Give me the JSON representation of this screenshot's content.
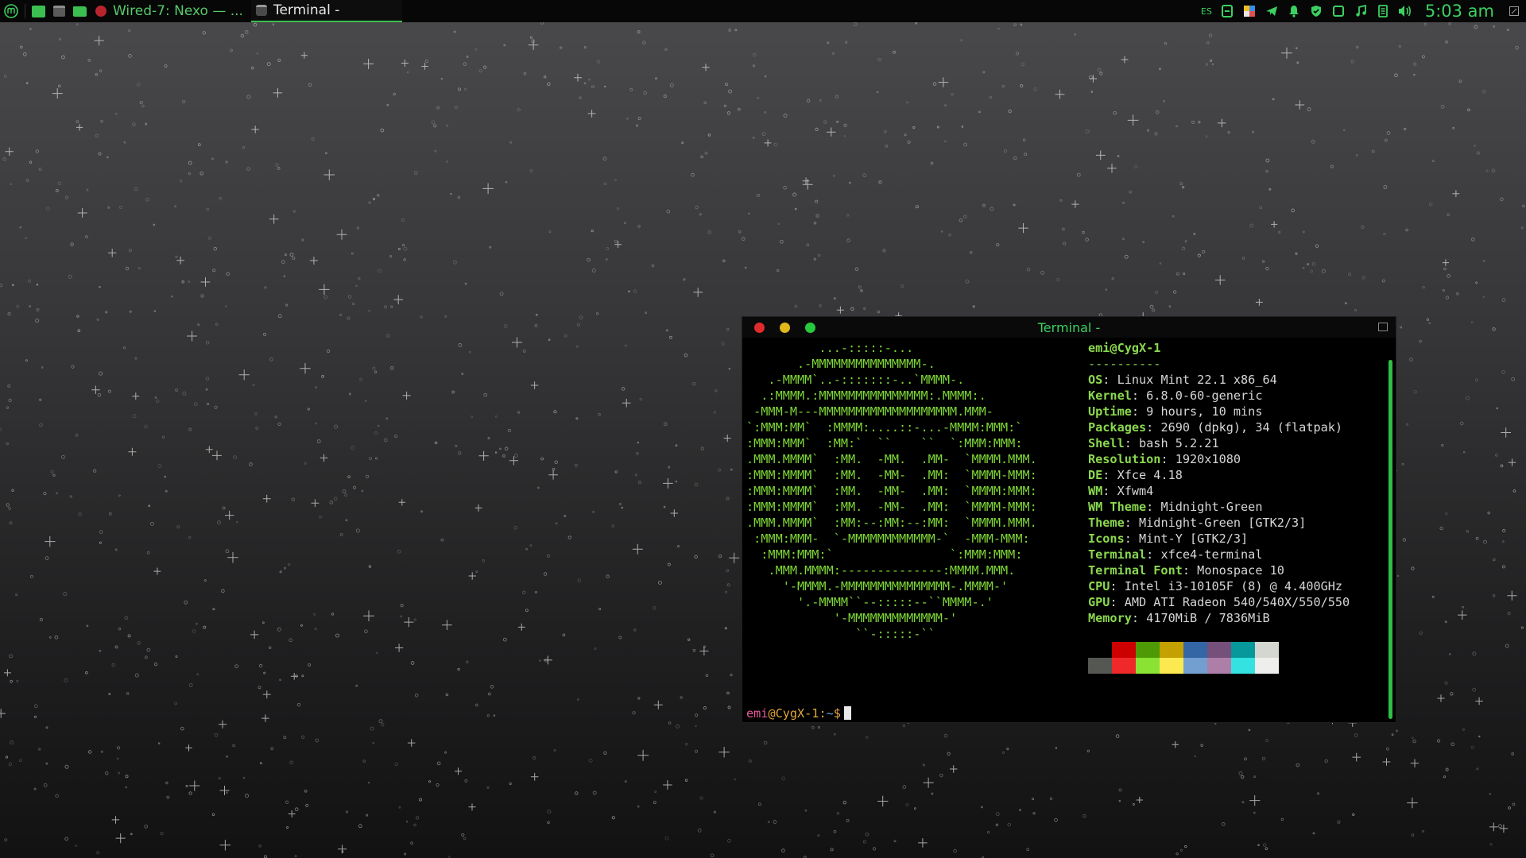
{
  "panel": {
    "tasks": [
      {
        "label": "Wired-7: Nexo — ..."
      },
      {
        "label": "Terminal -"
      }
    ],
    "keyboard_layout": "ES",
    "clock": "5:03 am",
    "accent_color": "#3cd061"
  },
  "terminal": {
    "title": "Terminal -",
    "logo": [
      "          ...-:::::-...",
      "       .-MMMMMMMMMMMMMMM-.",
      "   .-MMMM`..-:::::::-..`MMMM-.",
      "  .:MMMM.:MMMMMMMMMMMMMMM:.MMMM:.",
      " -MMM-M---MMMMMMMMMMMMMMMMMMM.MMM-",
      "`:MMM:MM`  :MMMM:....::-...-MMMM:MMM:`",
      ":MMM:MMM`  :MM:`  ``    ``  `:MMM:MMM:",
      ".MMM.MMMM`  :MM.  -MM.  .MM-  `MMMM.MMM.",
      ":MMM:MMMM`  :MM.  -MM-  .MM:  `MMMM-MMM:",
      ":MMM:MMMM`  :MM.  -MM-  .MM:  `MMMM:MMM:",
      ":MMM:MMMM`  :MM.  -MM-  .MM:  `MMMM-MMM:",
      ".MMM.MMMM`  :MM:--:MM:--:MM:  `MMMM.MMM.",
      " :MMM:MMM-  `-MMMMMMMMMMMM-`  -MMM-MMM:",
      "  :MMM:MMM:`                `:MMM:MMM:",
      "   .MMM.MMMM:--------------:MMMM.MMM.",
      "     '-MMMM.-MMMMMMMMMMMMMMM-.MMMM-'",
      "       '.-MMMM``--:::::--``MMMM-.'",
      "            '-MMMMMMMMMMMMM-'",
      "               ``-:::::-``"
    ],
    "user_host": "emi@CygX-1",
    "separator": "----------",
    "info": [
      {
        "key": "OS",
        "value": "Linux Mint 22.1 x86_64"
      },
      {
        "key": "Kernel",
        "value": "6.8.0-60-generic"
      },
      {
        "key": "Uptime",
        "value": "9 hours, 10 mins"
      },
      {
        "key": "Packages",
        "value": "2690 (dpkg), 34 (flatpak)"
      },
      {
        "key": "Shell",
        "value": "bash 5.2.21"
      },
      {
        "key": "Resolution",
        "value": "1920x1080"
      },
      {
        "key": "DE",
        "value": "Xfce 4.18"
      },
      {
        "key": "WM",
        "value": "Xfwm4"
      },
      {
        "key": "WM Theme",
        "value": "Midnight-Green"
      },
      {
        "key": "Theme",
        "value": "Midnight-Green [GTK2/3]"
      },
      {
        "key": "Icons",
        "value": "Mint-Y [GTK2/3]"
      },
      {
        "key": "Terminal",
        "value": "xfce4-terminal"
      },
      {
        "key": "Terminal Font",
        "value": "Monospace 10"
      },
      {
        "key": "CPU",
        "value": "Intel i3-10105F (8) @ 4.400GHz"
      },
      {
        "key": "GPU",
        "value": "AMD ATI Radeon 540/540X/550/550"
      },
      {
        "key": "Memory",
        "value": "4170MiB / 7836MiB"
      }
    ],
    "palette_top": [
      "#000000",
      "#cc0000",
      "#4e9a06",
      "#c4a000",
      "#3465a4",
      "#75507b",
      "#06989a",
      "#d3d7cf"
    ],
    "palette_bottom": [
      "#555753",
      "#ef2929",
      "#8ae234",
      "#fce94f",
      "#729fcf",
      "#ad7fa8",
      "#34e2e2",
      "#eeeeec"
    ],
    "prompt": {
      "user": "emi",
      "at": "@",
      "host": "CygX-1",
      "sep": ":",
      "path": "~",
      "sigil": "$"
    }
  }
}
